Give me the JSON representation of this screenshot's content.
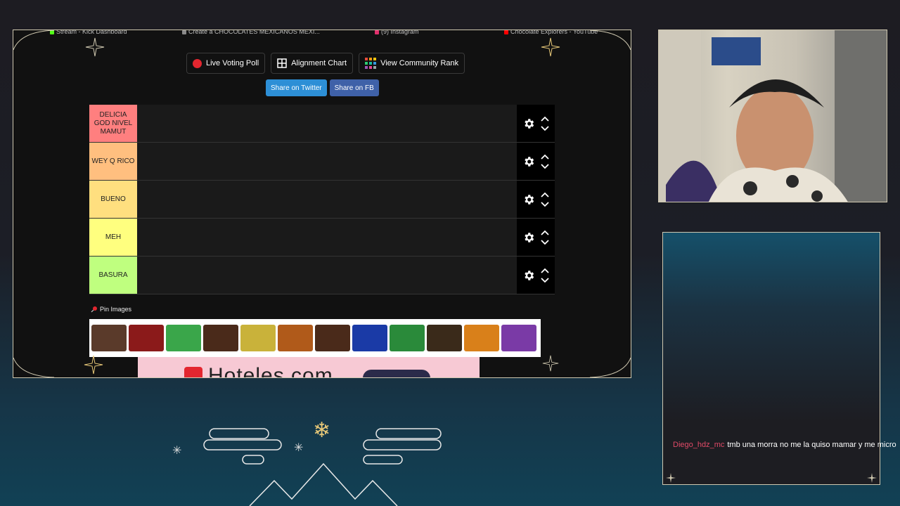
{
  "browser": {
    "tabs": [
      {
        "label": "Stream - Kick Dashboard",
        "color": "#53fc18"
      },
      {
        "label": "Create a CHOCOLATES MEXICANOS MEXI...",
        "color": "#8a8a8a"
      },
      {
        "label": "(9) Instagram",
        "color": "#e1306c"
      },
      {
        "label": "Chocolate Explorers - YouTube",
        "color": "#ff0000"
      }
    ]
  },
  "toolbar": {
    "live_voting_label": "Live Voting Poll",
    "alignment_label": "Alignment Chart",
    "community_label": "View Community Rank",
    "share_twitter_label": "Share on Twitter",
    "share_fb_label": "Share on FB"
  },
  "tiers": [
    {
      "label": "DELICIA GOD NIVEL MAMUT",
      "color": "#ff7f7f"
    },
    {
      "label": "WEY Q RICO",
      "color": "#ffbf7f"
    },
    {
      "label": "BUENO",
      "color": "#ffdf7f"
    },
    {
      "label": "MEH",
      "color": "#ffff7f"
    },
    {
      "label": "BASURA",
      "color": "#bfff7f"
    }
  ],
  "pin_images_label": "Pin Images",
  "candies": [
    {
      "name": "milky-way",
      "color": "#5a3a2a"
    },
    {
      "name": "dove",
      "color": "#8b1a1a"
    },
    {
      "name": "bocadin",
      "color": "#3aa64a"
    },
    {
      "name": "mms",
      "color": "#4a2a1a"
    },
    {
      "name": "cake",
      "color": "#c9b23a"
    },
    {
      "name": "bag",
      "color": "#b05a1a"
    },
    {
      "name": "hersheys",
      "color": "#4a2a1a"
    },
    {
      "name": "dove-2",
      "color": "#1a3aa6"
    },
    {
      "name": "almond",
      "color": "#2a8a3a"
    },
    {
      "name": "snickers",
      "color": "#3a2a1a"
    },
    {
      "name": "canasta",
      "color": "#d9801a"
    },
    {
      "name": "mix",
      "color": "#7a3aa6"
    }
  ],
  "ad": {
    "text": "Hoteles.com"
  },
  "chat": {
    "username": "Diego_hdz_mc",
    "message": "tmb una morra no me la quiso mamar y me micro"
  },
  "colors": {
    "frame_border": "#cfc8b0",
    "accent_gold": "#e7c878"
  }
}
